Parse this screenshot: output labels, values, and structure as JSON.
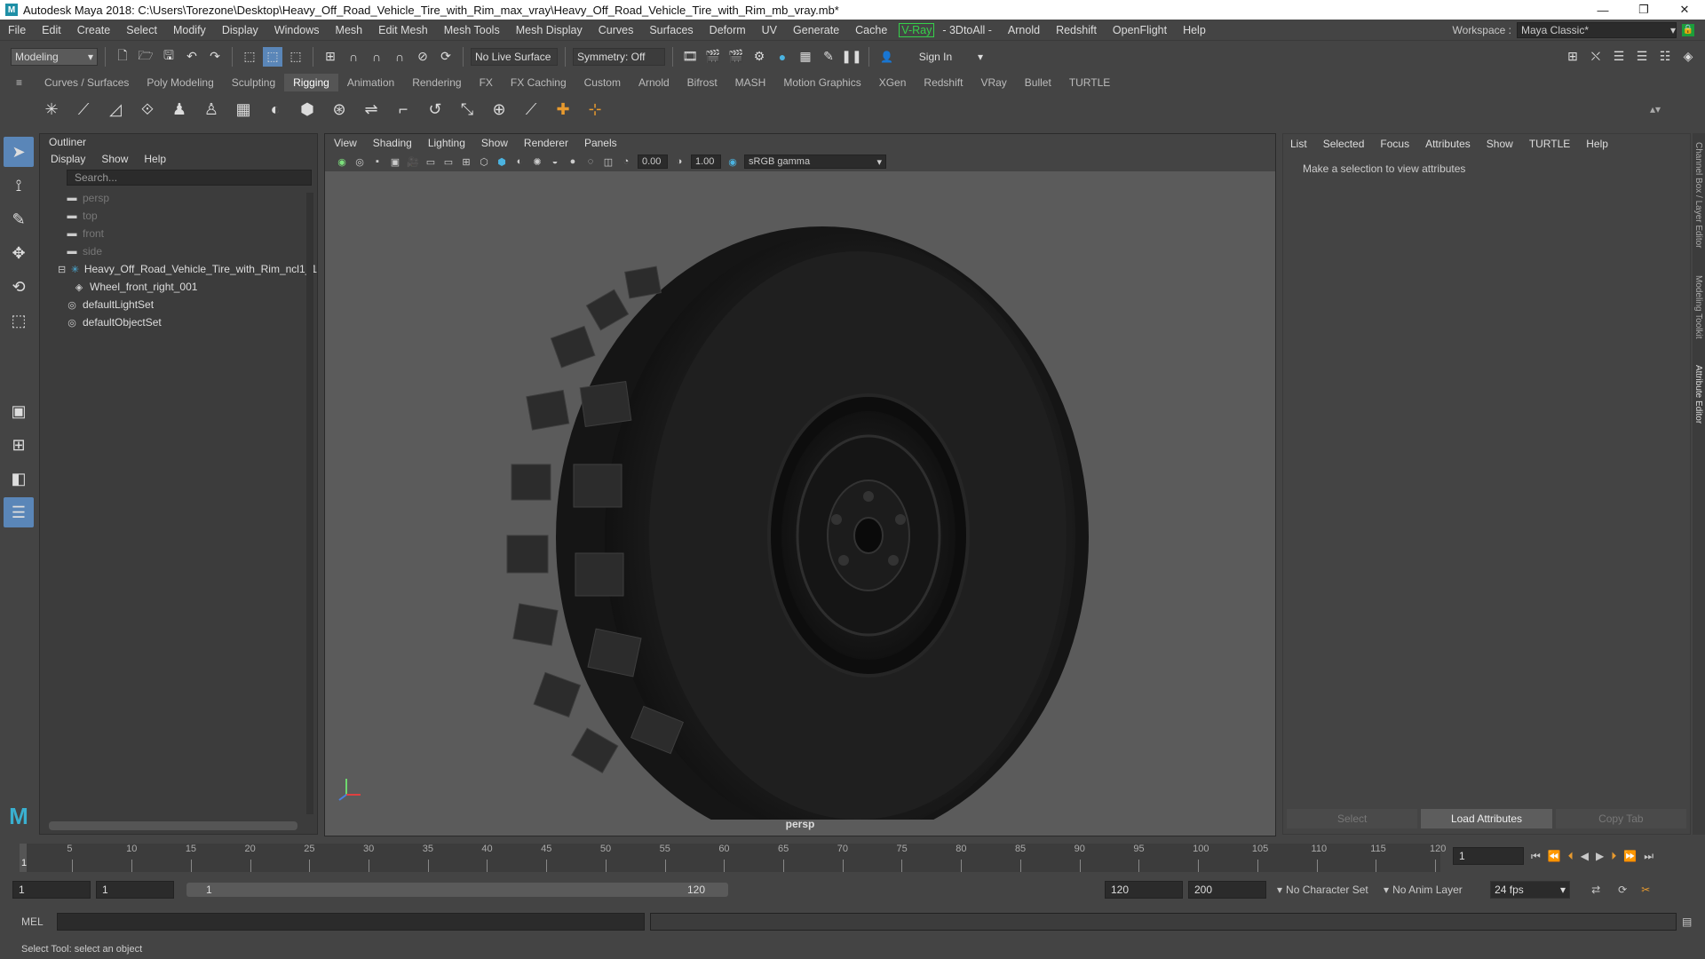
{
  "window": {
    "title": "Autodesk Maya 2018: C:\\Users\\Torezone\\Desktop\\Heavy_Off_Road_Vehicle_Tire_with_Rim_max_vray\\Heavy_Off_Road_Vehicle_Tire_with_Rim_mb_vray.mb*"
  },
  "menu": {
    "items": [
      "File",
      "Edit",
      "Create",
      "Select",
      "Modify",
      "Display",
      "Windows",
      "Mesh",
      "Edit Mesh",
      "Mesh Tools",
      "Mesh Display",
      "Curves",
      "Surfaces",
      "Deform",
      "UV",
      "Generate",
      "Cache"
    ],
    "vray": "V-Ray",
    "items2": [
      "- 3DtoAll -",
      "Arnold",
      "Redshift",
      "OpenFlight",
      "Help"
    ],
    "workspace_label": "Workspace :",
    "workspace_value": "Maya Classic*"
  },
  "status": {
    "mode": "Modeling",
    "live_surface": "No Live Surface",
    "symmetry": "Symmetry: Off",
    "sign_in": "Sign In"
  },
  "shelf": {
    "tabs": [
      "Curves / Surfaces",
      "Poly Modeling",
      "Sculpting",
      "Rigging",
      "Animation",
      "Rendering",
      "FX",
      "FX Caching",
      "Custom",
      "Arnold",
      "Bifrost",
      "MASH",
      "Motion Graphics",
      "XGen",
      "Redshift",
      "VRay",
      "Bullet",
      "TURTLE"
    ],
    "active": "Rigging"
  },
  "outliner": {
    "title": "Outliner",
    "menu": [
      "Display",
      "Show",
      "Help"
    ],
    "search_placeholder": "Search...",
    "items": [
      {
        "label": "persp",
        "dim": true,
        "icon": "camera-icon"
      },
      {
        "label": "top",
        "dim": true,
        "icon": "camera-icon"
      },
      {
        "label": "front",
        "dim": true,
        "icon": "camera-icon"
      },
      {
        "label": "side",
        "dim": true,
        "icon": "camera-icon"
      },
      {
        "label": "Heavy_Off_Road_Vehicle_Tire_with_Rim_ncl1_1",
        "dim": false,
        "icon": "group-icon"
      },
      {
        "label": "Wheel_front_right_001",
        "dim": false,
        "icon": "mesh-icon"
      },
      {
        "label": "defaultLightSet",
        "dim": false,
        "icon": "set-icon"
      },
      {
        "label": "defaultObjectSet",
        "dim": false,
        "icon": "set-icon"
      }
    ]
  },
  "viewport": {
    "menu": [
      "View",
      "Shading",
      "Lighting",
      "Show",
      "Renderer",
      "Panels"
    ],
    "exposure": "0.00",
    "gamma_value": "1.00",
    "color_space": "sRGB gamma",
    "camera": "persp"
  },
  "attributes": {
    "menu": [
      "List",
      "Selected",
      "Focus",
      "Attributes",
      "Show",
      "TURTLE",
      "Help"
    ],
    "message": "Make a selection to view attributes",
    "buttons": [
      "Select",
      "Load Attributes",
      "Copy Tab"
    ]
  },
  "side_tabs": [
    "Channel Box / Layer Editor",
    "Modeling Toolkit",
    "Attribute Editor"
  ],
  "timeline": {
    "ticks": [
      "5",
      "10",
      "15",
      "20",
      "25",
      "30",
      "35",
      "40",
      "45",
      "50",
      "55",
      "60",
      "65",
      "70",
      "75",
      "80",
      "85",
      "90",
      "95",
      "100",
      "105",
      "110",
      "115",
      "120"
    ],
    "start_marker": "1",
    "current_frame": "1"
  },
  "range": {
    "start": "1",
    "start2": "1",
    "slider_start": "1",
    "slider_end": "120",
    "end": "120",
    "end2": "200",
    "character_set": "No Character Set",
    "anim_layer": "No Anim Layer",
    "fps": "24 fps"
  },
  "command": {
    "label": "MEL"
  },
  "help_line": "Select Tool: select an object"
}
